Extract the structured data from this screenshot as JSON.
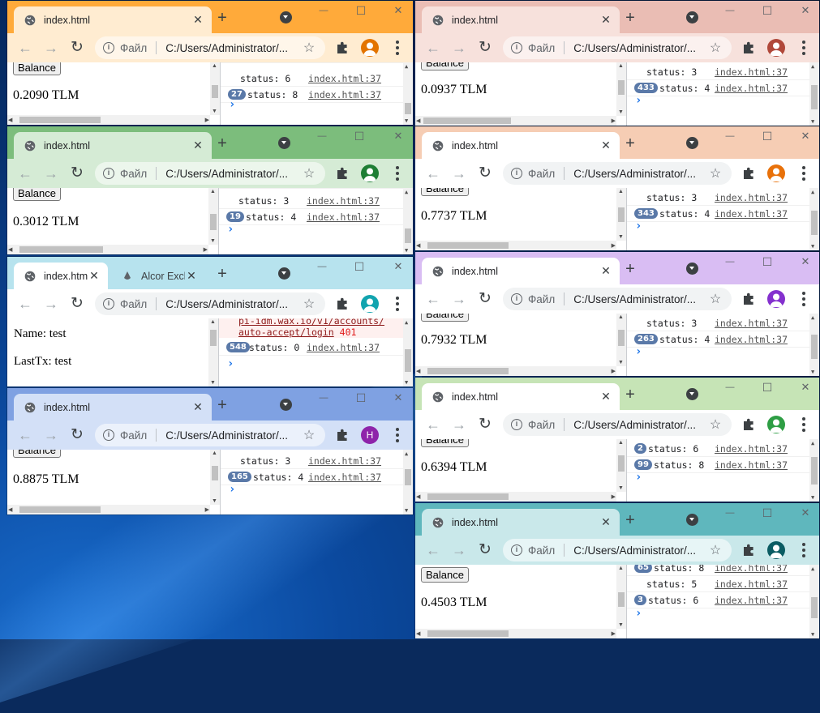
{
  "common": {
    "tab_title": "index.html",
    "url": "C:/Users/Administrator/...",
    "file_label": "Файл",
    "balance_button": "Balance",
    "devtools_source": "index.html:37"
  },
  "windows": [
    {
      "id": "w1",
      "tab_color": "#ffaa3a",
      "active_tab_color": "#ffecd1",
      "toolbar_color": "#ffecd1",
      "avatar_color": "#e37400",
      "balance": "0.2090 TLM",
      "console": [
        {
          "badge": "",
          "text": "status: 6"
        },
        {
          "badge": "27",
          "text": "status: 8"
        }
      ]
    },
    {
      "id": "w2",
      "tab_color": "#eabdb4",
      "active_tab_color": "#f7e1dc",
      "toolbar_color": "#f7e1dc",
      "avatar_color": "#b0483a",
      "balance": "0.0937 TLM",
      "console": [
        {
          "badge": "",
          "text": "status: 3"
        },
        {
          "badge": "433",
          "text": "status: 4"
        }
      ]
    },
    {
      "id": "w3",
      "tab_color": "#7cbd7c",
      "active_tab_color": "#d5ebd5",
      "toolbar_color": "#d5ebd5",
      "avatar_color": "#1e7e34",
      "balance": "0.3012 TLM",
      "console": [
        {
          "badge": "",
          "text": "status: 3"
        },
        {
          "badge": "19",
          "text": "status: 4"
        }
      ]
    },
    {
      "id": "w4",
      "tab_color": "#f6cdb4",
      "active_tab_color": "#ffffff",
      "toolbar_color": "#ffffff",
      "avatar_color": "#e8710a",
      "balance": "0.7737 TLM",
      "console": [
        {
          "badge": "",
          "text": "status: 3"
        },
        {
          "badge": "343",
          "text": "status: 4"
        }
      ]
    },
    {
      "id": "w5",
      "tab_color": "#b7e3ee",
      "active_tab_color": "#ffffff",
      "toolbar_color": "#ffffff",
      "avatar_color": "#12a4af",
      "second_tab": "Alcor Excl",
      "name_line": "Name: test",
      "lasttx_line": "LastTx: test",
      "error": {
        "url1": "pi-idm.wax.io/v1/accounts/",
        "url2": "auto-accept/login",
        "code": "401"
      },
      "console": [
        {
          "badge": "548",
          "text": "status: 0"
        }
      ]
    },
    {
      "id": "w6",
      "tab_color": "#d9bdf3",
      "active_tab_color": "#ffffff",
      "toolbar_color": "#ffffff",
      "avatar_color": "#8430ce",
      "balance": "0.7932 TLM",
      "console": [
        {
          "badge": "",
          "text": "status: 3"
        },
        {
          "badge": "263",
          "text": "status: 4"
        }
      ]
    },
    {
      "id": "w7",
      "tab_color": "#7fa1e2",
      "active_tab_color": "#d3e0f7",
      "toolbar_color": "#d3e0f7",
      "avatar_color": "#8e24aa",
      "avatar_letter": "H",
      "balance": "0.8875 TLM",
      "console": [
        {
          "badge": "",
          "text": "status: 3"
        },
        {
          "badge": "165",
          "text": "status: 4"
        }
      ]
    },
    {
      "id": "w8",
      "tab_color": "#c6e4b6",
      "active_tab_color": "#ffffff",
      "toolbar_color": "#ffffff",
      "avatar_color": "#2e9e44",
      "balance": "0.6394 TLM",
      "console": [
        {
          "badge": "2",
          "text": "status: 6"
        },
        {
          "badge": "99",
          "text": "status: 8"
        }
      ]
    },
    {
      "id": "w9",
      "tab_color": "#5fb7bd",
      "active_tab_color": "#c9e8ea",
      "toolbar_color": "#c9e8ea",
      "avatar_color": "#0b5c63",
      "balance": "0.4503 TLM",
      "console": [
        {
          "badge": "65",
          "text": "status: 8"
        },
        {
          "badge": "",
          "text": "status: 5"
        },
        {
          "badge": "3",
          "text": "status: 6"
        }
      ]
    }
  ]
}
